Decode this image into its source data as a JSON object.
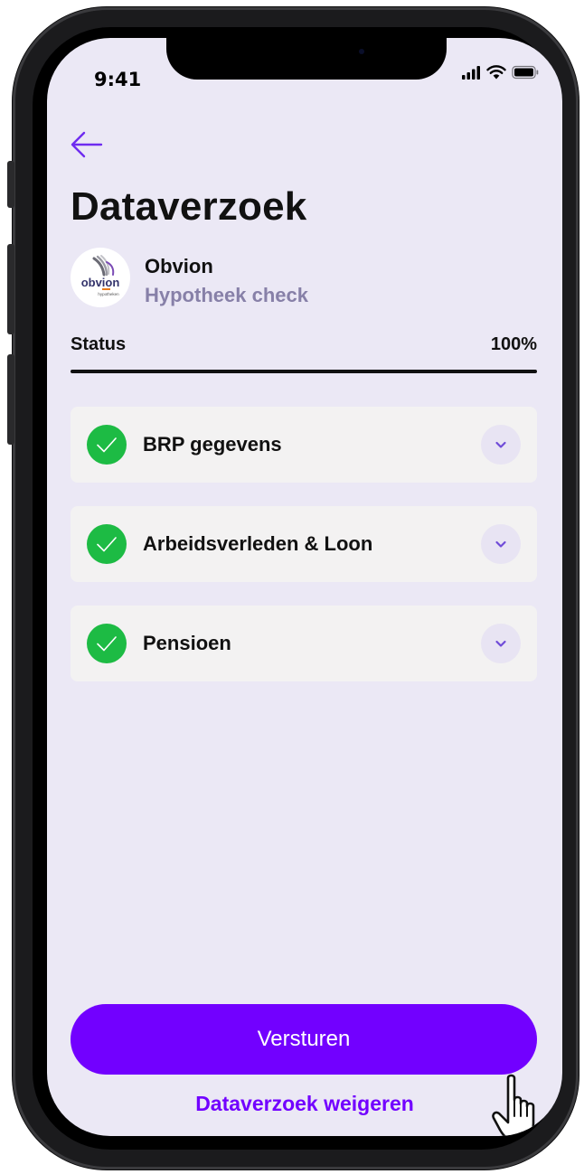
{
  "status_bar": {
    "time": "9:41"
  },
  "header": {
    "title": "Dataverzoek"
  },
  "requester": {
    "name": "Obvion",
    "subtitle": "Hypotheek check",
    "logo_text": "obvion",
    "logo_subtext": "hypotheken"
  },
  "progress": {
    "label": "Status",
    "value_text": "100%",
    "value": 1.0
  },
  "items": [
    {
      "label": "BRP gegevens",
      "status": "complete"
    },
    {
      "label": "Arbeidsverleden & Loon",
      "status": "complete"
    },
    {
      "label": "Pensioen",
      "status": "complete"
    }
  ],
  "actions": {
    "submit_label": "Versturen",
    "reject_label": "Dataverzoek weigeren"
  },
  "icons": {
    "back": "arrow-left-icon",
    "check": "check-icon",
    "expand": "chevron-down-icon",
    "cursor": "hand-pointer-icon",
    "signal": "signal-icon",
    "wifi": "wifi-icon",
    "battery": "battery-icon"
  },
  "colors": {
    "accent": "#7200ff",
    "success": "#1dbb44",
    "screen_bg": "#ebe8f5",
    "card_bg": "#f3f2f2",
    "muted_text": "#8780a8"
  }
}
